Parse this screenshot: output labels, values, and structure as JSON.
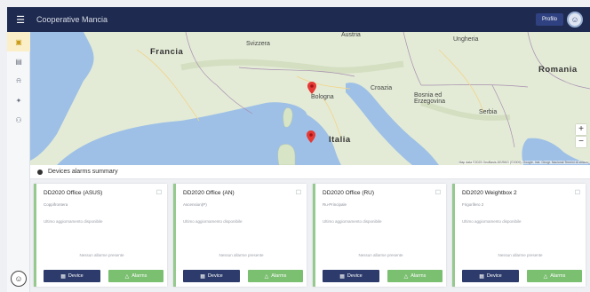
{
  "topbar": {
    "menu_icon": "hamburger-icon",
    "title": "Cooperative Mancia",
    "user_label": "Profilo",
    "avatar_icon": "user-avatar-icon"
  },
  "sidebar": {
    "items": [
      {
        "icon": "folder-icon",
        "glyph": "▣",
        "active": true
      },
      {
        "icon": "document-icon",
        "glyph": "▤",
        "active": false
      },
      {
        "icon": "bell-icon",
        "glyph": "♫",
        "active": false
      },
      {
        "icon": "gear-icon",
        "glyph": "✦",
        "active": false
      },
      {
        "icon": "users-icon",
        "glyph": "⚇",
        "active": false
      }
    ],
    "bottom_icon": "help-icon"
  },
  "map": {
    "labels": {
      "francia": "Francia",
      "svizzera": "Svizzera",
      "austria": "Austria",
      "ungheria": "Ungheria",
      "romania": "Romania",
      "croazia": "Croazia",
      "bosnia": "Bosnia ed Erzegovina",
      "serbia": "Serbia",
      "italia": "Italia",
      "bologna": "Bologna"
    },
    "zoom_in": "+",
    "zoom_out": "−",
    "attribution": "Map data ©2023 GeoBasis-DE/BKG (©2009), Google, Inst. Geogr. Nacional   Termini di utilizzo"
  },
  "summary": {
    "title": "Devices alarms summary"
  },
  "cards": [
    {
      "title": "DD2020 Office (ASUS)",
      "sub": "Coppifrontera",
      "desc": "Ultimo aggiornamento disponibile",
      "status": "Nessun allarme presente",
      "device_label": "Device",
      "alarms_label": "Alarms"
    },
    {
      "title": "DD2020 Office (AN)",
      "sub": "Ascension(P)",
      "desc": "Ultimo aggiornamento disponibile",
      "status": "Nessun allarme presente",
      "device_label": "Device",
      "alarms_label": "Alarms"
    },
    {
      "title": "DD2020 Office (RU)",
      "sub": "Ru-Principale",
      "desc": "Ultimo aggiornamento disponibile",
      "status": "Nessun allarme presente",
      "device_label": "Device",
      "alarms_label": "Alarms"
    },
    {
      "title": "DD2020 Weightbox 2",
      "sub": "Frigorifero 2",
      "desc": "Ultimo aggiornamento disponibile",
      "status": "Nessun allarme presente",
      "device_label": "Device",
      "alarms_label": "Alarms"
    }
  ],
  "colors": {
    "topbar": "#1e2a4f",
    "accent_green": "#7bbf71",
    "device_button": "#2c3b6b",
    "marker_red": "#e53935"
  }
}
